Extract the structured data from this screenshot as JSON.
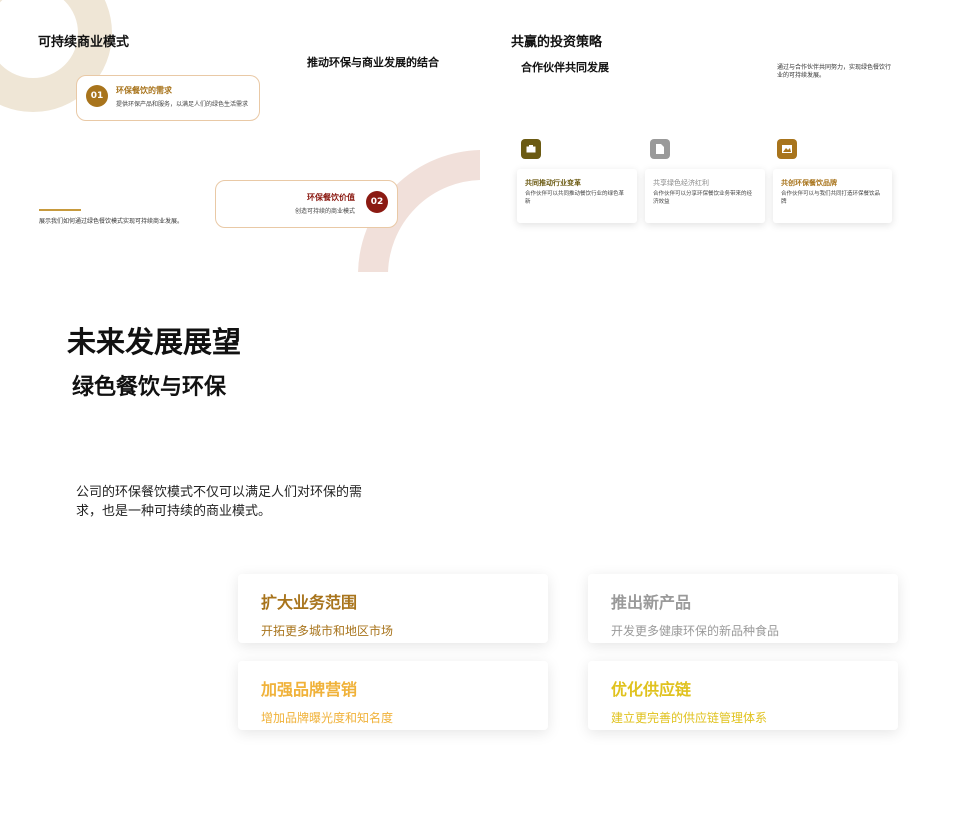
{
  "slide1": {
    "title": "可持续商业模式",
    "subtitle": "推动环保与商业发展的结合",
    "card1": {
      "num": "01",
      "title": "环保餐饮的需求",
      "desc": "提供环保产品和服务，以满足人们的绿色生活需求"
    },
    "card2": {
      "num": "02",
      "title": "环保餐饮价值",
      "desc": "创造可持续的商业模式"
    },
    "caption": "展示我们如何通过绿色餐饮模式实现可持续商业发展。"
  },
  "slide2": {
    "title": "共赢的投资策略",
    "subtitle": "合作伙伴共同发展",
    "note": "通过与合作伙伴共同努力，实现绿色餐饮行业的可持续发展。",
    "cards": [
      {
        "icon": "briefcase-icon",
        "color": "#6b5a12",
        "title": "共同推动行业变革",
        "desc": "合作伙伴可以共同推动餐饮行业的绿色革新"
      },
      {
        "icon": "document-icon",
        "color": "#9a9a9a",
        "title": "共享绿色经济红利",
        "desc": "合作伙伴可以分享环保餐饮业务带来的经济效益"
      },
      {
        "icon": "image-icon",
        "color": "#a8741c",
        "title": "共创环保餐饮品牌",
        "desc": "合作伙伴可以与我们共同打造环保餐饮品牌"
      }
    ]
  },
  "slide3": {
    "title": "未来发展展望",
    "subtitle": "绿色餐饮与环保",
    "paragraph_line1": "公司的环保餐饮模式不仅可以满足人们对环保的需",
    "paragraph_line2": "求，也是一种可持续的商业模式。",
    "cards": [
      {
        "title": "扩大业务范围",
        "desc": "开拓更多城市和地区市场",
        "color": "#a8741c"
      },
      {
        "title": "推出新产品",
        "desc": "开发更多健康环保的新品种食品",
        "color": "#9a9a9a"
      },
      {
        "title": "加强品牌营销",
        "desc": "增加品牌曝光度和知名度",
        "color": "#f0b23a"
      },
      {
        "title": "优化供应链",
        "desc": "建立更完善的供应链管理体系",
        "color": "#e0c21e"
      }
    ]
  },
  "colors": {
    "brown": "#a8741c",
    "darkred": "#8b1a12",
    "accent": "#c79a3d"
  }
}
